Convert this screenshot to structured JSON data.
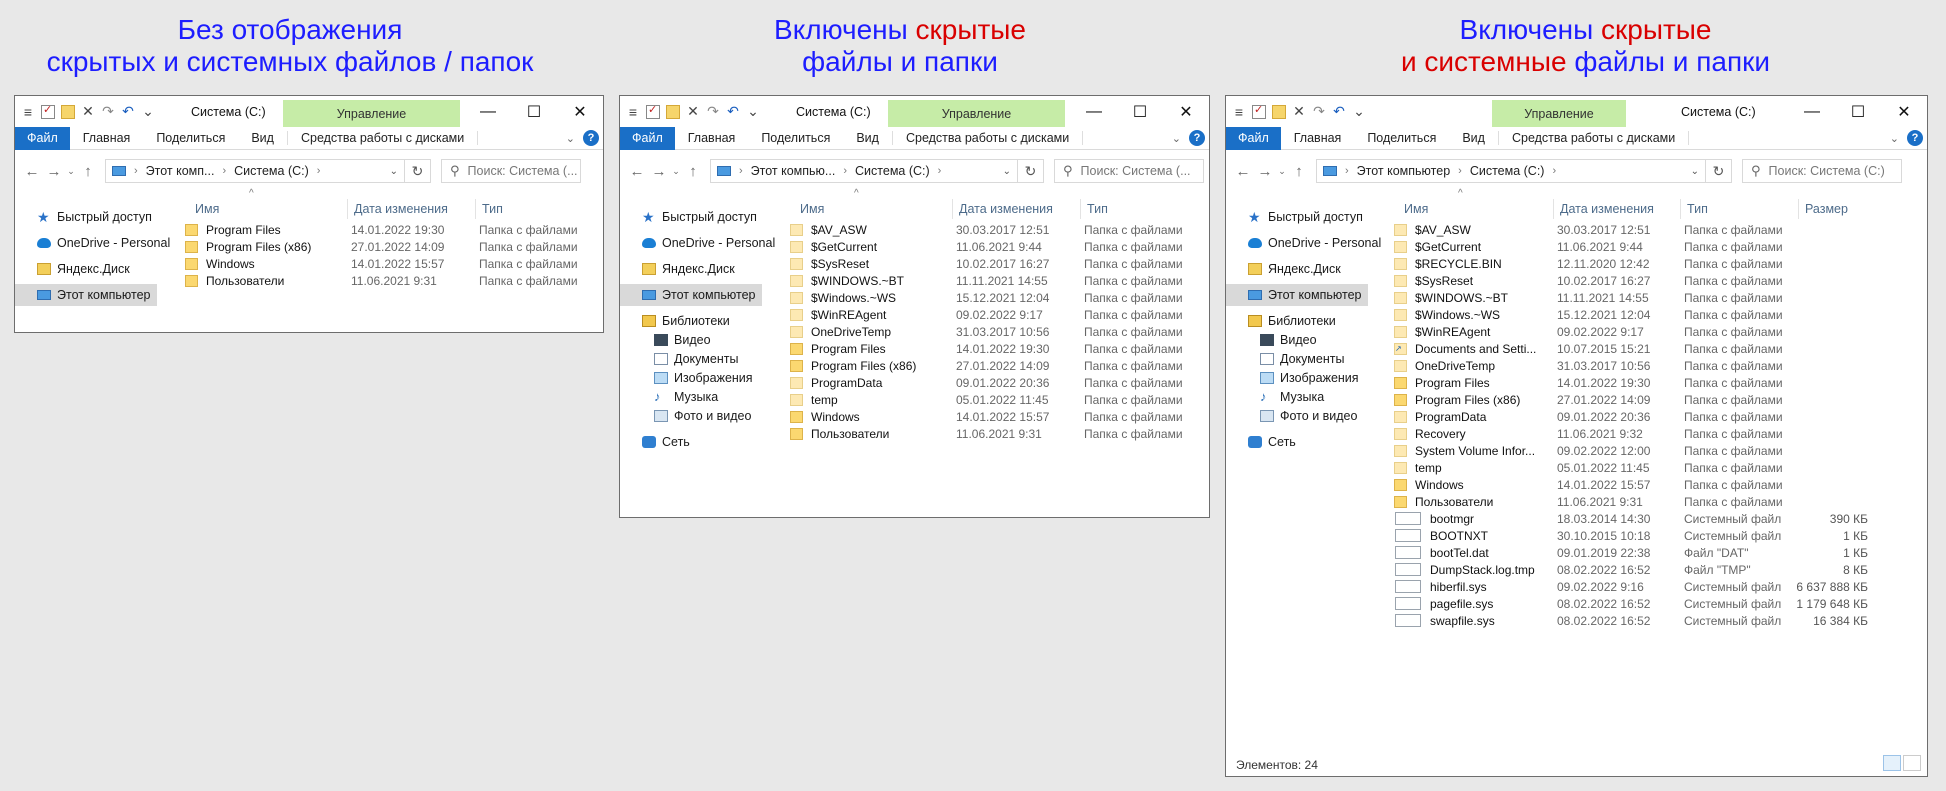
{
  "captions": [
    {
      "lines": [
        [
          {
            "text": "Без отображения",
            "color": "blue"
          }
        ],
        [
          {
            "text": "скрытых и системных файлов / папок",
            "color": "blue"
          }
        ]
      ]
    },
    {
      "lines": [
        [
          {
            "text": "Включены ",
            "color": "blue"
          },
          {
            "text": "скрытые",
            "color": "red"
          }
        ],
        [
          {
            "text": "файлы и папки",
            "color": "blue"
          }
        ]
      ]
    },
    {
      "lines": [
        [
          {
            "text": "Включены ",
            "color": "blue"
          },
          {
            "text": "скрытые",
            "color": "red"
          }
        ],
        [
          {
            "text": "и системные ",
            "color": "red"
          },
          {
            "text": "файлы и папки",
            "color": "blue"
          }
        ]
      ]
    }
  ],
  "common": {
    "manage": "Управление",
    "file_tab": "Файл",
    "tabs": [
      "Главная",
      "Поделиться",
      "Вид"
    ],
    "disk_tools": "Средства работы с дисками",
    "help": "?",
    "window_controls": {
      "minimize": "—",
      "maximize": "☐",
      "close": "✕"
    },
    "back": "←",
    "forward": "→",
    "recent": "⌄",
    "up": "↑",
    "refresh": "↻",
    "columns": {
      "name": "Имя",
      "date": "Дата изменения",
      "type": "Тип",
      "size": "Размер"
    },
    "sort_arrow": "^"
  },
  "windows": [
    {
      "title": "Система (C:)",
      "address": [
        "Этот комп...",
        "Система (C:)",
        ""
      ],
      "search": "Поиск: Система (...",
      "nav": [
        {
          "label": "Быстрый доступ",
          "icon": "star"
        },
        {
          "label": "OneDrive - Personal",
          "icon": "cloud"
        },
        {
          "label": "Яндекс.Диск",
          "icon": "ydisk"
        },
        {
          "label": "Этот компьютер",
          "icon": "pc",
          "selected": true
        }
      ],
      "files": [
        {
          "name": "Program Files",
          "date": "14.01.2022 19:30",
          "type": "Папка с файлами",
          "icon": "folder"
        },
        {
          "name": "Program Files (x86)",
          "date": "27.01.2022 14:09",
          "type": "Папка с файлами",
          "icon": "folder"
        },
        {
          "name": "Windows",
          "date": "14.01.2022 15:57",
          "type": "Папка с файлами",
          "icon": "folder"
        },
        {
          "name": "Пользователи",
          "date": "11.06.2021 9:31",
          "type": "Папка с файлами",
          "icon": "folder"
        }
      ]
    },
    {
      "title": "Система (C:)",
      "address": [
        "Этот компью...",
        "Система (C:)",
        ""
      ],
      "search": "Поиск: Система (...",
      "nav": [
        {
          "label": "Быстрый доступ",
          "icon": "star"
        },
        {
          "label": "OneDrive - Personal",
          "icon": "cloud"
        },
        {
          "label": "Яндекс.Диск",
          "icon": "ydisk"
        },
        {
          "label": "Этот компьютер",
          "icon": "pc",
          "selected": true
        },
        {
          "label": "Библиотеки",
          "icon": "lib"
        },
        {
          "label": "Видео",
          "icon": "vid",
          "indent": true
        },
        {
          "label": "Документы",
          "icon": "doc",
          "indent": true
        },
        {
          "label": "Изображения",
          "icon": "img",
          "indent": true
        },
        {
          "label": "Музыка",
          "icon": "mus",
          "indent": true
        },
        {
          "label": "Фото и видео",
          "icon": "pho",
          "indent": true
        },
        {
          "label": "Сеть",
          "icon": "net"
        }
      ],
      "files": [
        {
          "name": "$AV_ASW",
          "date": "30.03.2017 12:51",
          "type": "Папка с файлами",
          "icon": "hidden"
        },
        {
          "name": "$GetCurrent",
          "date": "11.06.2021 9:44",
          "type": "Папка с файлами",
          "icon": "hidden"
        },
        {
          "name": "$SysReset",
          "date": "10.02.2017 16:27",
          "type": "Папка с файлами",
          "icon": "hidden"
        },
        {
          "name": "$WINDOWS.~BT",
          "date": "11.11.2021 14:55",
          "type": "Папка с файлами",
          "icon": "hidden"
        },
        {
          "name": "$Windows.~WS",
          "date": "15.12.2021 12:04",
          "type": "Папка с файлами",
          "icon": "hidden"
        },
        {
          "name": "$WinREAgent",
          "date": "09.02.2022 9:17",
          "type": "Папка с файлами",
          "icon": "hidden"
        },
        {
          "name": "OneDriveTemp",
          "date": "31.03.2017 10:56",
          "type": "Папка с файлами",
          "icon": "hidden"
        },
        {
          "name": "Program Files",
          "date": "14.01.2022 19:30",
          "type": "Папка с файлами",
          "icon": "folder"
        },
        {
          "name": "Program Files (x86)",
          "date": "27.01.2022 14:09",
          "type": "Папка с файлами",
          "icon": "folder"
        },
        {
          "name": "ProgramData",
          "date": "09.01.2022 20:36",
          "type": "Папка с файлами",
          "icon": "hidden"
        },
        {
          "name": "temp",
          "date": "05.01.2022 11:45",
          "type": "Папка с файлами",
          "icon": "hidden"
        },
        {
          "name": "Windows",
          "date": "14.01.2022 15:57",
          "type": "Папка с файлами",
          "icon": "folder"
        },
        {
          "name": "Пользователи",
          "date": "11.06.2021 9:31",
          "type": "Папка с файлами",
          "icon": "folder"
        }
      ]
    },
    {
      "title": "Система (C:)",
      "address": [
        "Этот компьютер",
        "Система (C:)",
        ""
      ],
      "search": "Поиск: Система (C:)",
      "status": "Элементов: 24",
      "nav": [
        {
          "label": "Быстрый доступ",
          "icon": "star"
        },
        {
          "label": "OneDrive - Personal",
          "icon": "cloud"
        },
        {
          "label": "Яндекс.Диск",
          "icon": "ydisk"
        },
        {
          "label": "Этот компьютер",
          "icon": "pc",
          "selected": true
        },
        {
          "label": "Библиотеки",
          "icon": "lib"
        },
        {
          "label": "Видео",
          "icon": "vid",
          "indent": true
        },
        {
          "label": "Документы",
          "icon": "doc",
          "indent": true
        },
        {
          "label": "Изображения",
          "icon": "img",
          "indent": true
        },
        {
          "label": "Музыка",
          "icon": "mus",
          "indent": true
        },
        {
          "label": "Фото и видео",
          "icon": "pho",
          "indent": true
        },
        {
          "label": "Сеть",
          "icon": "net"
        }
      ],
      "files": [
        {
          "name": "$AV_ASW",
          "date": "30.03.2017 12:51",
          "type": "Папка с файлами",
          "size": "",
          "icon": "hidden"
        },
        {
          "name": "$GetCurrent",
          "date": "11.06.2021 9:44",
          "type": "Папка с файлами",
          "size": "",
          "icon": "hidden"
        },
        {
          "name": "$RECYCLE.BIN",
          "date": "12.11.2020 12:42",
          "type": "Папка с файлами",
          "size": "",
          "icon": "hidden"
        },
        {
          "name": "$SysReset",
          "date": "10.02.2017 16:27",
          "type": "Папка с файлами",
          "size": "",
          "icon": "hidden"
        },
        {
          "name": "$WINDOWS.~BT",
          "date": "11.11.2021 14:55",
          "type": "Папка с файлами",
          "size": "",
          "icon": "hidden"
        },
        {
          "name": "$Windows.~WS",
          "date": "15.12.2021 12:04",
          "type": "Папка с файлами",
          "size": "",
          "icon": "hidden"
        },
        {
          "name": "$WinREAgent",
          "date": "09.02.2022 9:17",
          "type": "Папка с файлами",
          "size": "",
          "icon": "hidden"
        },
        {
          "name": "Documents and Setti...",
          "date": "10.07.2015 15:21",
          "type": "Папка с файлами",
          "size": "",
          "icon": "link"
        },
        {
          "name": "OneDriveTemp",
          "date": "31.03.2017 10:56",
          "type": "Папка с файлами",
          "size": "",
          "icon": "hidden"
        },
        {
          "name": "Program Files",
          "date": "14.01.2022 19:30",
          "type": "Папка с файлами",
          "size": "",
          "icon": "folder"
        },
        {
          "name": "Program Files (x86)",
          "date": "27.01.2022 14:09",
          "type": "Папка с файлами",
          "size": "",
          "icon": "folder"
        },
        {
          "name": "ProgramData",
          "date": "09.01.2022 20:36",
          "type": "Папка с файлами",
          "size": "",
          "icon": "hidden"
        },
        {
          "name": "Recovery",
          "date": "11.06.2021 9:32",
          "type": "Папка с файлами",
          "size": "",
          "icon": "hidden"
        },
        {
          "name": "System Volume Infor...",
          "date": "09.02.2022 12:00",
          "type": "Папка с файлами",
          "size": "",
          "icon": "hidden"
        },
        {
          "name": "temp",
          "date": "05.01.2022 11:45",
          "type": "Папка с файлами",
          "size": "",
          "icon": "hidden"
        },
        {
          "name": "Windows",
          "date": "14.01.2022 15:57",
          "type": "Папка с файлами",
          "size": "",
          "icon": "folder"
        },
        {
          "name": "Пользователи",
          "date": "11.06.2021 9:31",
          "type": "Папка с файлами",
          "size": "",
          "icon": "folder"
        },
        {
          "name": "bootmgr",
          "date": "18.03.2014 14:30",
          "type": "Системный файл",
          "size": "390 КБ",
          "icon": "file"
        },
        {
          "name": "BOOTNXT",
          "date": "30.10.2015 10:18",
          "type": "Системный файл",
          "size": "1 КБ",
          "icon": "file"
        },
        {
          "name": "bootTel.dat",
          "date": "09.01.2019 22:38",
          "type": "Файл \"DAT\"",
          "size": "1 КБ",
          "icon": "file"
        },
        {
          "name": "DumpStack.log.tmp",
          "date": "08.02.2022 16:52",
          "type": "Файл \"TMP\"",
          "size": "8 КБ",
          "icon": "file"
        },
        {
          "name": "hiberfil.sys",
          "date": "09.02.2022 9:16",
          "type": "Системный файл",
          "size": "6 637 888 КБ",
          "icon": "file"
        },
        {
          "name": "pagefile.sys",
          "date": "08.02.2022 16:52",
          "type": "Системный файл",
          "size": "1 179 648 КБ",
          "icon": "file"
        },
        {
          "name": "swapfile.sys",
          "date": "08.02.2022 16:52",
          "type": "Системный файл",
          "size": "16 384 КБ",
          "icon": "file"
        }
      ]
    }
  ]
}
